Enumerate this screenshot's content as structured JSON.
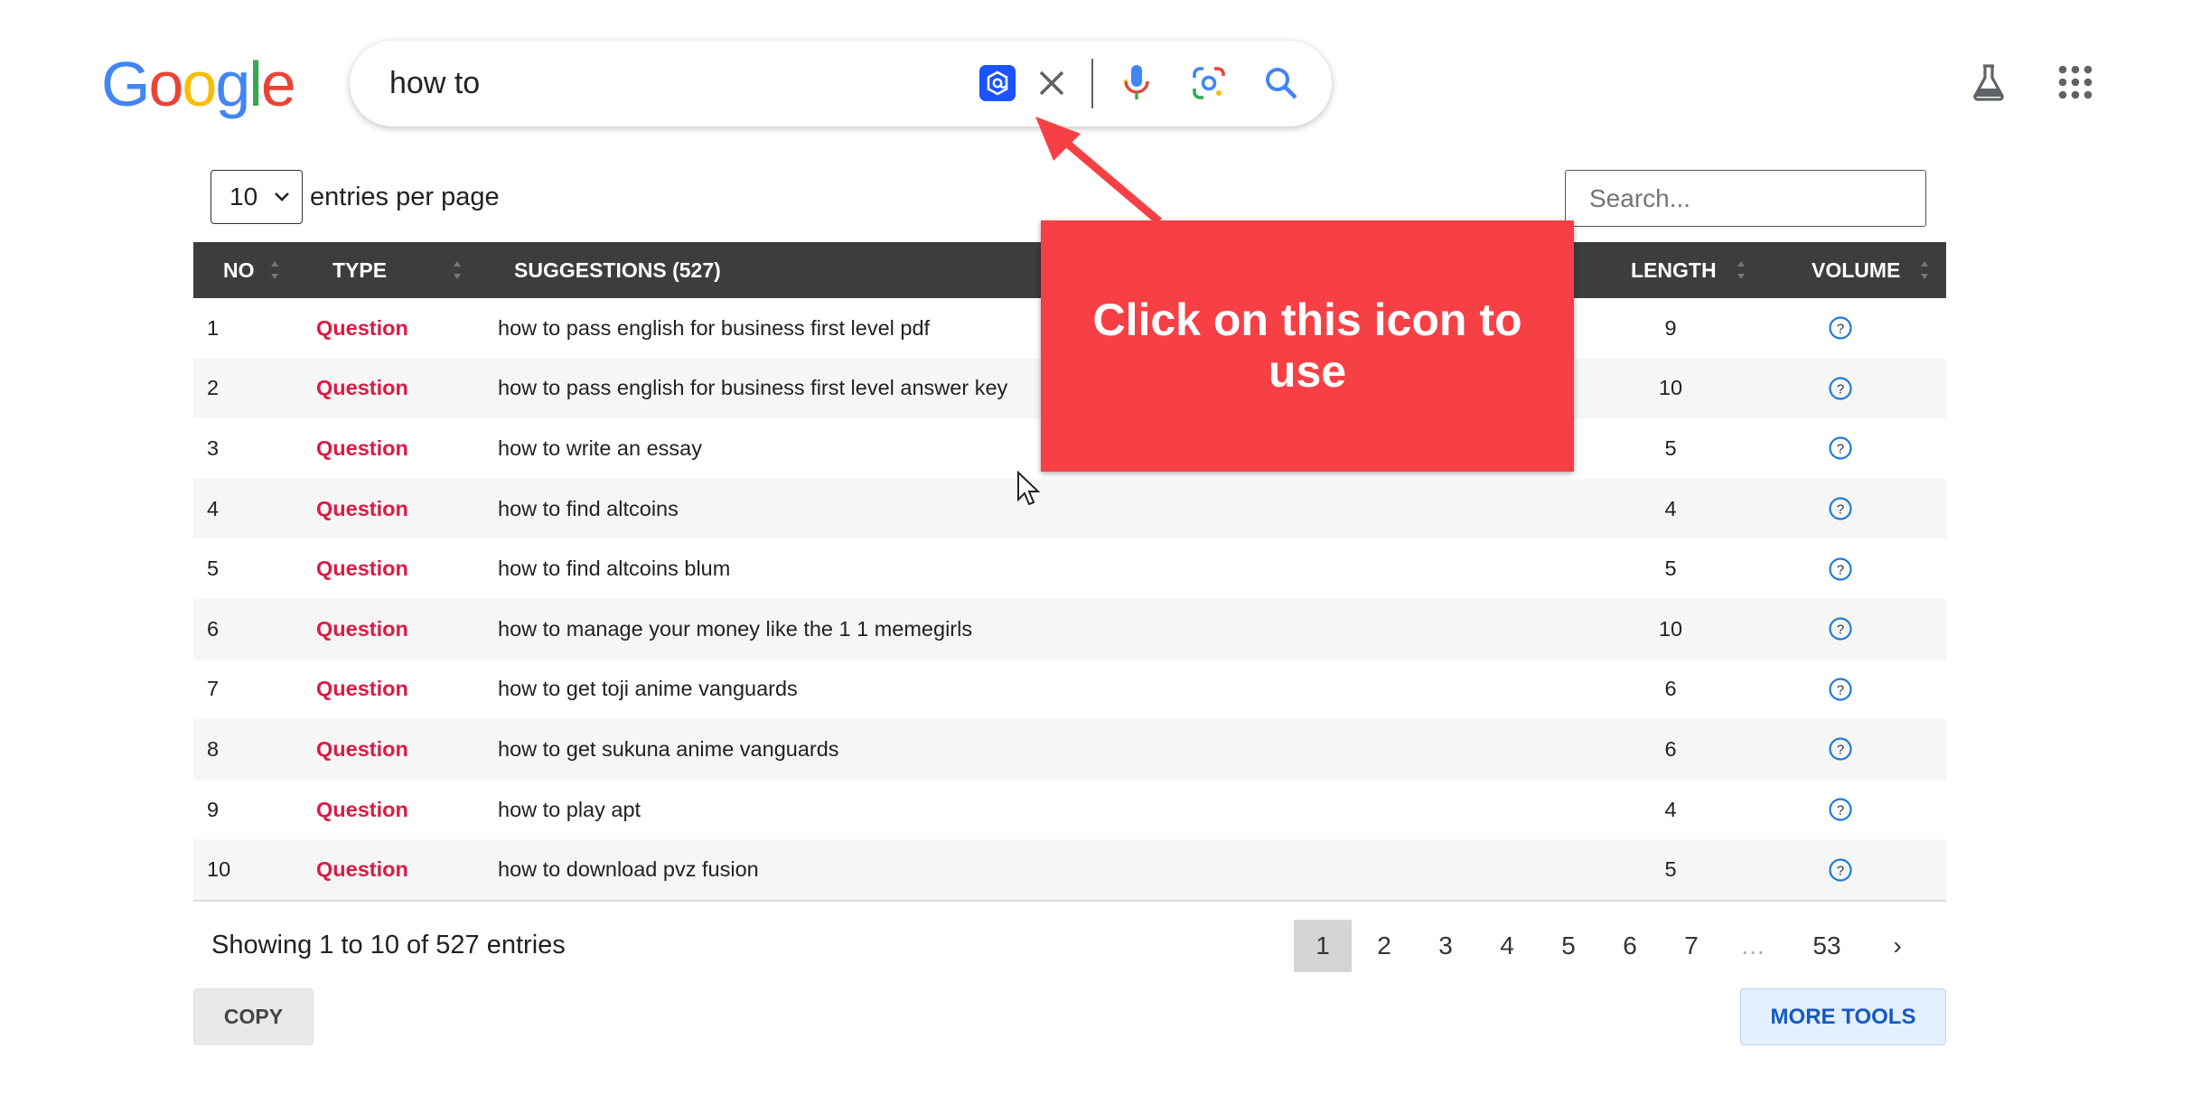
{
  "logo": {
    "letters": [
      "G",
      "o",
      "o",
      "g",
      "l",
      "e"
    ],
    "colors": [
      "#4285F4",
      "#EA4335",
      "#FBBC05",
      "#4285F4",
      "#34A853",
      "#EA4335"
    ]
  },
  "search": {
    "query": "how to"
  },
  "search_icons": [
    "keyword-tool-icon",
    "clear-icon",
    "mic-icon",
    "lens-icon",
    "search-icon"
  ],
  "top_right_icons": [
    "labs-flask-icon",
    "apps-grid-icon"
  ],
  "controls": {
    "entries_value": "10",
    "entries_label": "entries per page",
    "search_placeholder": "Search..."
  },
  "table": {
    "headers": {
      "no": "NO",
      "type": "TYPE",
      "suggestions": "SUGGESTIONS (527)",
      "length": "LENGTH",
      "volume": "VOLUME"
    },
    "rows": [
      {
        "no": "1",
        "type": "Question",
        "suggestion": "how to pass english for business first level pdf",
        "length": "9"
      },
      {
        "no": "2",
        "type": "Question",
        "suggestion": "how to pass english for business first level answer key",
        "length": "10"
      },
      {
        "no": "3",
        "type": "Question",
        "suggestion": "how to write an essay",
        "length": "5"
      },
      {
        "no": "4",
        "type": "Question",
        "suggestion": "how to find altcoins",
        "length": "4"
      },
      {
        "no": "5",
        "type": "Question",
        "suggestion": "how to find altcoins blum",
        "length": "5"
      },
      {
        "no": "6",
        "type": "Question",
        "suggestion": "how to manage your money like the 1 1 memegirls",
        "length": "10"
      },
      {
        "no": "7",
        "type": "Question",
        "suggestion": "how to get toji anime vanguards",
        "length": "6"
      },
      {
        "no": "8",
        "type": "Question",
        "suggestion": "how to get sukuna anime vanguards",
        "length": "6"
      },
      {
        "no": "9",
        "type": "Question",
        "suggestion": "how to play apt",
        "length": "4"
      },
      {
        "no": "10",
        "type": "Question",
        "suggestion": "how to download pvz fusion",
        "length": "5"
      }
    ]
  },
  "footer": {
    "showing": "Showing 1 to 10 of 527 entries",
    "pages": [
      "1",
      "2",
      "3",
      "4",
      "5",
      "6",
      "7",
      "…",
      "53",
      "›"
    ],
    "active_page": "1",
    "copy_label": "COPY",
    "more_tools_label": "MORE TOOLS"
  },
  "callout": {
    "text": "Click on this icon to use",
    "color": "#f74045"
  },
  "colors": {
    "accent": "#dc1a44",
    "header_bg": "#3d3d3d",
    "tool_icon_bg": "#1a53ff"
  }
}
